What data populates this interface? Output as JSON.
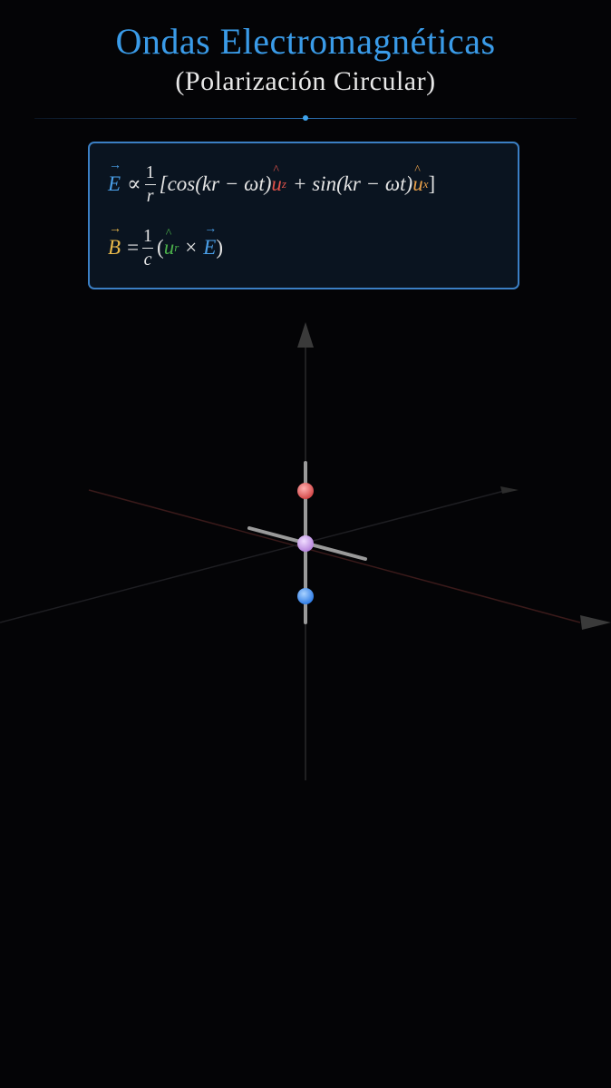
{
  "header": {
    "title": "Ondas Electromagnéticas",
    "subtitle": "(Polarización Circular)"
  },
  "equations": {
    "E_symbol": "E",
    "prop": "∝",
    "one": "1",
    "r": "r",
    "cos_part": "[cos(kr − ωt)",
    "u": "u",
    "z": "z",
    "plus_sin": "+ sin(kr − ωt)",
    "x": "x",
    "close_bracket": "]",
    "B_symbol": "B",
    "equals": "=",
    "c": "c",
    "open_paren": "(",
    "r_sub": "r",
    "times": "×",
    "close_paren": ")"
  },
  "colors": {
    "title": "#3a9be8",
    "E": "#4a9fe8",
    "B": "#e8b84a",
    "uz": "#e0524a",
    "ux": "#e8a04a",
    "ur": "#4bb04a",
    "point_top": "#e05a5a",
    "point_center": "#c79be6",
    "point_bottom": "#3d8ef0",
    "axis": "#9a9a9a",
    "box_border": "#3b7fc4"
  },
  "scene": {
    "points": [
      {
        "name": "positive-charge-point",
        "color_key": "point_top"
      },
      {
        "name": "center-point",
        "color_key": "point_center"
      },
      {
        "name": "negative-charge-point",
        "color_key": "point_bottom"
      }
    ]
  }
}
